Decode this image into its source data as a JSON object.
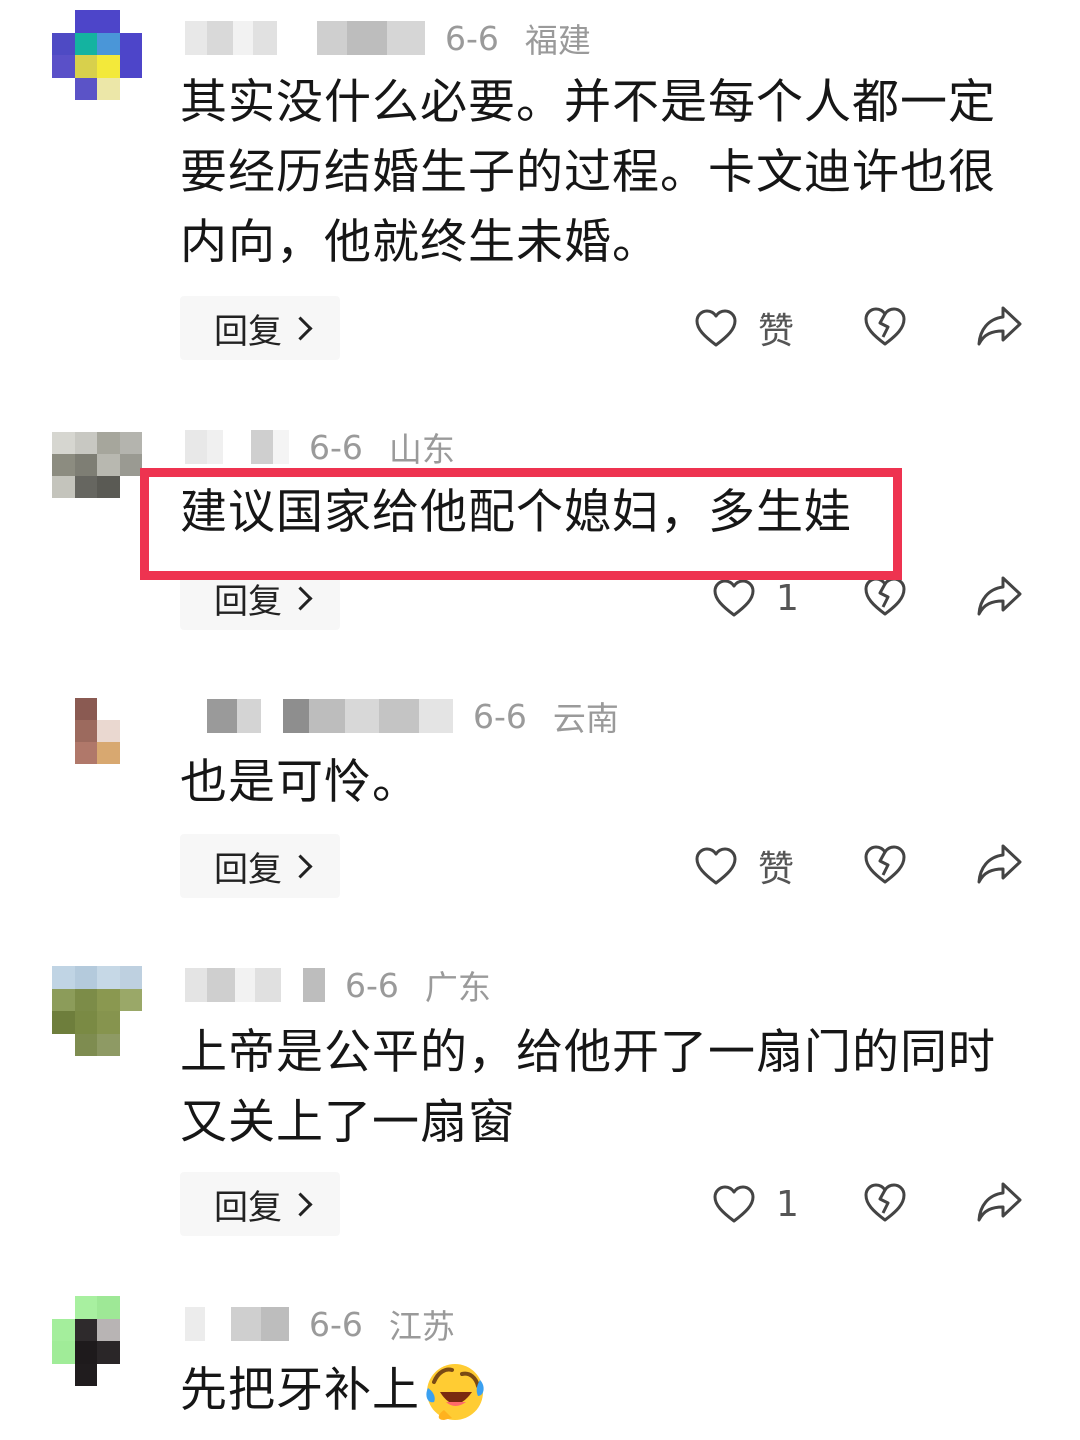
{
  "colors": {
    "highlight": "#ee3350",
    "meta_text": "#9a9a9a",
    "reply_bg": "#f7f7f7"
  },
  "comments": [
    {
      "date": "6-6",
      "region": "福建",
      "text_lines": [
        "其实没什么必要。并不是每个人都一定",
        "要经历结婚生子的过程。卡文迪许也很",
        "内向，他就终生未婚。"
      ],
      "reply_label": "回复",
      "like_label": "赞"
    },
    {
      "date": "6-6",
      "region": "山东",
      "text_lines": [
        "建议国家给他配个媳妇，多生娃"
      ],
      "reply_label": "回复",
      "like_label": "1"
    },
    {
      "date": "6-6",
      "region": "云南",
      "text_lines": [
        "也是可怜。"
      ],
      "reply_label": "回复",
      "like_label": "赞"
    },
    {
      "date": "6-6",
      "region": "广东",
      "text_lines": [
        "上帝是公平的，给他开了一扇门的同时",
        "又关上了一扇窗"
      ],
      "reply_label": "回复",
      "like_label": "1"
    },
    {
      "date": "6-6",
      "region": "江苏",
      "text_lines": [
        "先把牙补上"
      ],
      "emoji": "laughing-crying-emoji"
    }
  ]
}
